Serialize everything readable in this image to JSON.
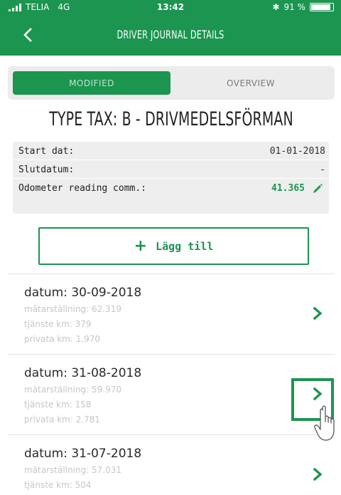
{
  "status_bar": {
    "carrier": "TELIA",
    "network": "4G",
    "time": "13:42",
    "bluetooth": "✱",
    "battery_text": "91 %",
    "battery_level": 0.91
  },
  "header": {
    "title": "DRIVER JOURNAL DETAILS",
    "back_icon": "chevron-left-icon"
  },
  "tabs": {
    "modified": "MODIFIED",
    "overview": "OVERVIEW",
    "active": "modified"
  },
  "tax_title": "TYPE TAX: B - DRIVMEDELSFÖRMAN",
  "info": {
    "start_label": "Start dat:",
    "start_value": "01-01-2018",
    "end_label": "Slutdatum:",
    "end_value": "-",
    "odometer_label": "Odometer reading comm.:",
    "odometer_value": "41.365",
    "edit_icon": "pencil-icon"
  },
  "add_button": {
    "icon": "plus-icon",
    "label": "Lägg till"
  },
  "journal_items": [
    {
      "date": "datum: 30-09-2018",
      "line1": "mätarställning: 62.319",
      "line2": "tjänste km: 379",
      "line3": "privata km: 1.970"
    },
    {
      "date": "datum: 31-08-2018",
      "line1": "mätarställning: 59.970",
      "line2": "tjänste km: 158",
      "line3": "privata km: 2.781"
    },
    {
      "date": "datum: 31-07-2018",
      "line1": "mätarställning: 57.031",
      "line2": "tjänste km: 504",
      "line3": ""
    }
  ],
  "colors": {
    "brand_green": "#1b9550",
    "tab_bg": "#ececec",
    "info_bg": "#eeeeee",
    "muted_text": "#c6c6c6"
  },
  "overlay": {
    "highlight_icon": "highlight-box",
    "cursor_icon": "hand-pointer-icon"
  }
}
